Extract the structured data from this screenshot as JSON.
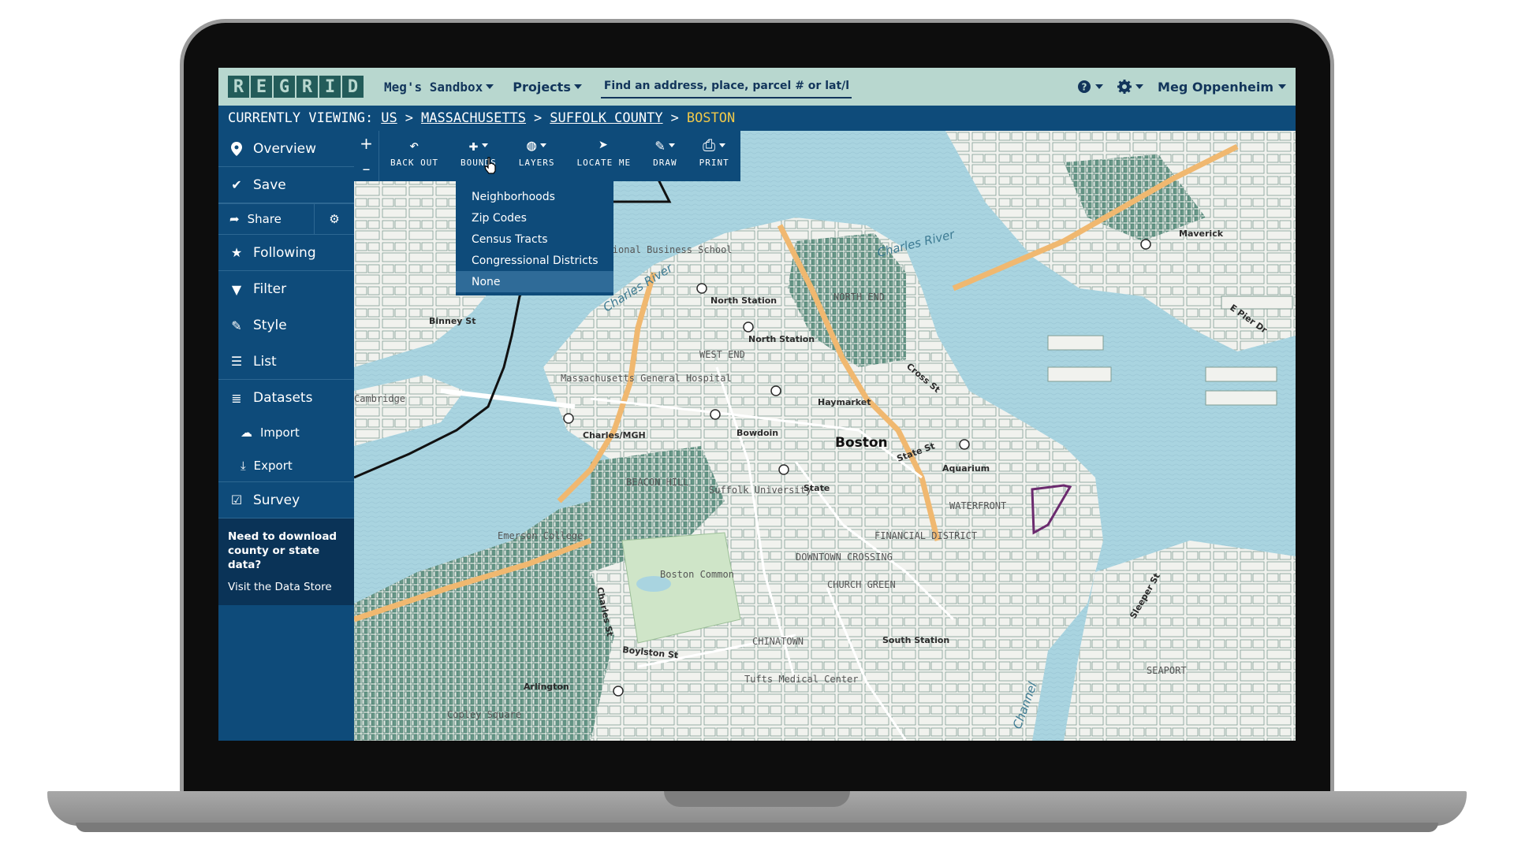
{
  "topnav": {
    "logo_letters": [
      "R",
      "E",
      "G",
      "R",
      "I",
      "D"
    ],
    "sandbox_label": "Meg's Sandbox",
    "projects_label": "Projects",
    "search_placeholder": "Find an address, place, parcel # or lat/long",
    "help_icon": "help-icon",
    "settings_icon": "gear-icon",
    "user_name": "Meg Oppenheim"
  },
  "breadcrumb": {
    "prefix": "CURRENTLY VIEWING:",
    "separator": ">",
    "items": [
      "US",
      "MASSACHUSETTS",
      "SUFFOLK COUNTY"
    ],
    "current": "BOSTON"
  },
  "sidebar": {
    "overview": "Overview",
    "save": "Save",
    "share": "Share",
    "following": "Following",
    "filter": "Filter",
    "style": "Style",
    "list": "List",
    "datasets": "Datasets",
    "import": "Import",
    "export": "Export",
    "survey": "Survey",
    "promo": "Need to download county or state data?",
    "store_link": "Visit the Data Store"
  },
  "zoom": {
    "in": "+",
    "out": "–"
  },
  "toolbar": {
    "back_out": "BACK OUT",
    "bounds": "BOUNDS",
    "layers": "LAYERS",
    "locate_me": "LOCATE ME",
    "draw": "DRAW",
    "print": "PRINT"
  },
  "bounds_menu": {
    "options": [
      "Neighborhoods",
      "Zip Codes",
      "Census Tracts",
      "Congressional Districts",
      "None"
    ],
    "selected": "None"
  },
  "map": {
    "labels": {
      "charles_river_top": "Charles River",
      "charles_river_left": "Charles River",
      "boston": "Boston",
      "north_station_1": "North Station",
      "north_station_2": "North Station",
      "west_end": "WEST END",
      "haymarket": "Haymarket",
      "bowdoin": "Bowdoin",
      "charles_mgh": "Charles/MGH",
      "state": "State",
      "aquarium": "Aquarium",
      "waterfront": "WATERFRONT",
      "financial_district": "FINANCIAL DISTRICT",
      "downtown_crossing": "DOWNTOWN CROSSING",
      "church_green": "CHURCH GREEN",
      "chinatown": "CHINATOWN",
      "south_station": "South Station",
      "boston_common": "Boston Common",
      "beacon_hill": "BEACON HILL",
      "seaport": "SEAPORT",
      "maverick": "Maverick",
      "arlington": "Arlington",
      "binney_st": "Binney St",
      "cambridge": "Cambridge",
      "mass_general": "Massachusetts General Hospital",
      "emerson": "Emerson College",
      "suffolk": "Suffolk University",
      "boylston": "Boylston St",
      "copley": "Copley Square",
      "charles_st": "Charles St",
      "state_st": "State St",
      "cross_st": "Cross St",
      "north_end": "NORTH END",
      "sleeper_st": "Sleeper St",
      "channel": "Channel",
      "tufts": "Tufts Medical Center",
      "e_pier_dr": "E Pier Dr",
      "international": "International Business School"
    },
    "colors": {
      "water": "#a9d4e0",
      "land": "#eef0ea",
      "park": "#cfe5c8",
      "parcel": "#2d6b5c",
      "highway": "#f0b870",
      "boundary": "#111111",
      "selection": "#6b2a6e"
    }
  }
}
